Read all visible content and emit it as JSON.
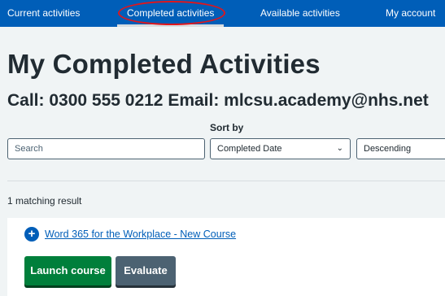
{
  "nav": {
    "items": [
      {
        "label": "Current activities"
      },
      {
        "label": "Completed activities",
        "active": true
      },
      {
        "label": "Available activities"
      },
      {
        "label": "My account"
      }
    ]
  },
  "page": {
    "title": "My Completed Activities",
    "contact": "Call: 0300 555 0212 Email: mlcsu.academy@nhs.net"
  },
  "filters": {
    "sort_label": "Sort by",
    "search_placeholder": "Search",
    "sort_field": "Completed Date",
    "sort_order": "Descending"
  },
  "results": {
    "count_text": "1 matching result",
    "items": [
      {
        "title": "Word 365 for the Workplace - New Course",
        "launch_label": "Launch course",
        "evaluate_label": "Evaluate"
      }
    ]
  },
  "colors": {
    "brand": "#005eb8",
    "highlight": "#e0161c",
    "primary_button": "#007f3b",
    "secondary_button": "#4c6272"
  }
}
